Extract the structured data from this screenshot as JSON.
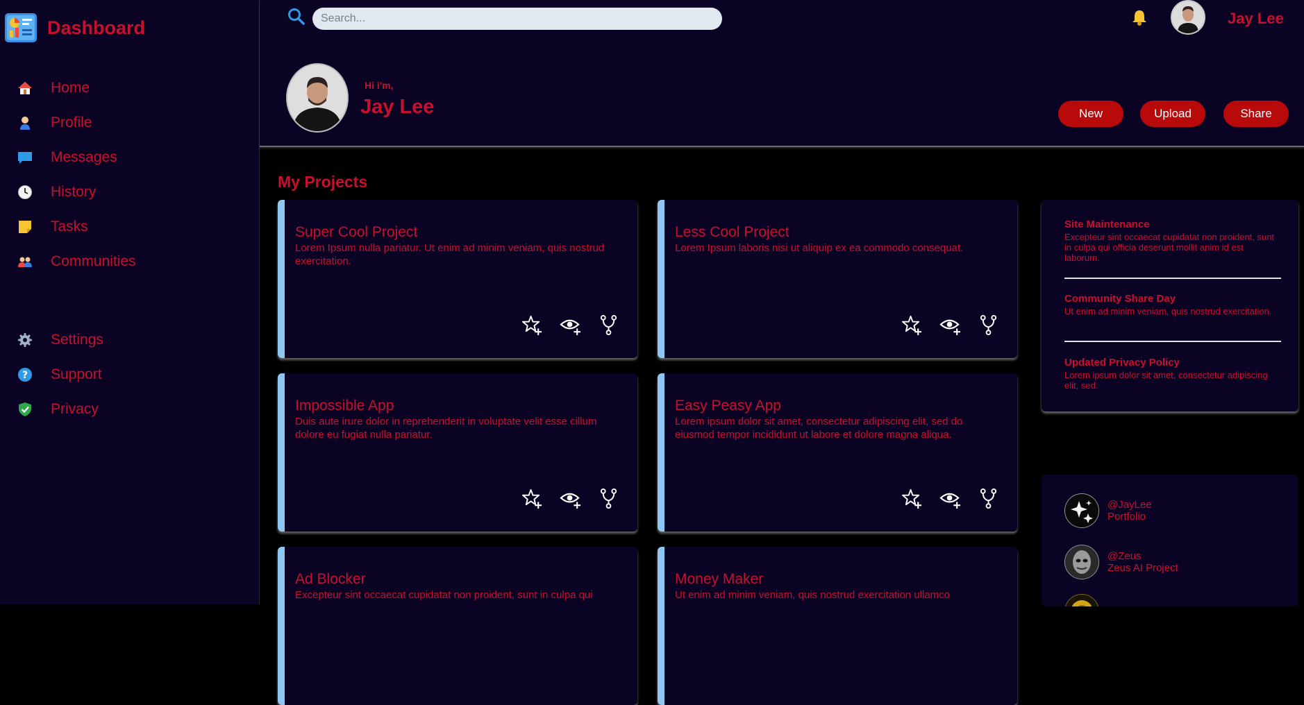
{
  "brand": {
    "title": "Dashboard"
  },
  "nav": {
    "primary": [
      {
        "label": "Home",
        "icon": "home-icon"
      },
      {
        "label": "Profile",
        "icon": "profile-icon"
      },
      {
        "label": "Messages",
        "icon": "messages-icon"
      },
      {
        "label": "History",
        "icon": "clock-icon"
      },
      {
        "label": "Tasks",
        "icon": "sticky-note-icon"
      },
      {
        "label": "Communities",
        "icon": "people-icon"
      }
    ],
    "secondary": [
      {
        "label": "Settings",
        "icon": "gear-icon"
      },
      {
        "label": "Support",
        "icon": "help-icon"
      },
      {
        "label": "Privacy",
        "icon": "shield-icon"
      }
    ]
  },
  "header": {
    "search_placeholder": "Search...",
    "user_name": "Jay Lee",
    "greeting": "Hi i'm,",
    "hero_name": "Jay Lee",
    "buttons": {
      "new": "New",
      "upload": "Upload",
      "share": "Share"
    }
  },
  "projects": {
    "title": "My Projects",
    "items": [
      {
        "title": "Super Cool Project",
        "desc": "Lorem Ipsum nulla pariatur. Ut enim ad minim veniam, quis nostrud exercitation."
      },
      {
        "title": "Less Cool Project",
        "desc": "Lorem Ipsum laboris nisi ut aliquip ex ea commodo consequat."
      },
      {
        "title": "Impossible App",
        "desc": "Duis aute irure dolor in reprehenderit in voluptate velit esse cillum dolore eu fugiat nulla pariatur."
      },
      {
        "title": "Easy Peasy App",
        "desc": "Lorem ipsum dolor sit amet, consectetur adipiscing elit, sed do eiusmod tempor incididunt ut labore et dolore magna aliqua."
      },
      {
        "title": "Ad Blocker",
        "desc": "Excepteur sint occaecat cupidatat non proident, sunt in culpa qui"
      },
      {
        "title": "Money Maker",
        "desc": "Ut enim ad minim veniam, quis nostrud exercitation ullamco"
      }
    ]
  },
  "announcements": [
    {
      "title": "Site Maintenance",
      "text": "Excepteur sint occaecat cupidatat non proident, sunt in culpa qui officia deserunt mollit anim id est laborum."
    },
    {
      "title": "Community Share Day",
      "text": "Ut enim ad minim veniam, quis nostrud exercitation."
    },
    {
      "title": "Updated Privacy Policy",
      "text": "Lorem ipsum dolor sit amet, consectetur adipiscing elit, sed."
    }
  ],
  "trending": [
    {
      "handle": "@JayLee",
      "project": "Portfolio"
    },
    {
      "handle": "@Zeus",
      "project": "Zeus AI Project"
    }
  ],
  "colors": {
    "accent": "#c8102e",
    "panel": "#0b0323",
    "card_stripe": "#8ec8f2",
    "button": "#b8090b"
  }
}
